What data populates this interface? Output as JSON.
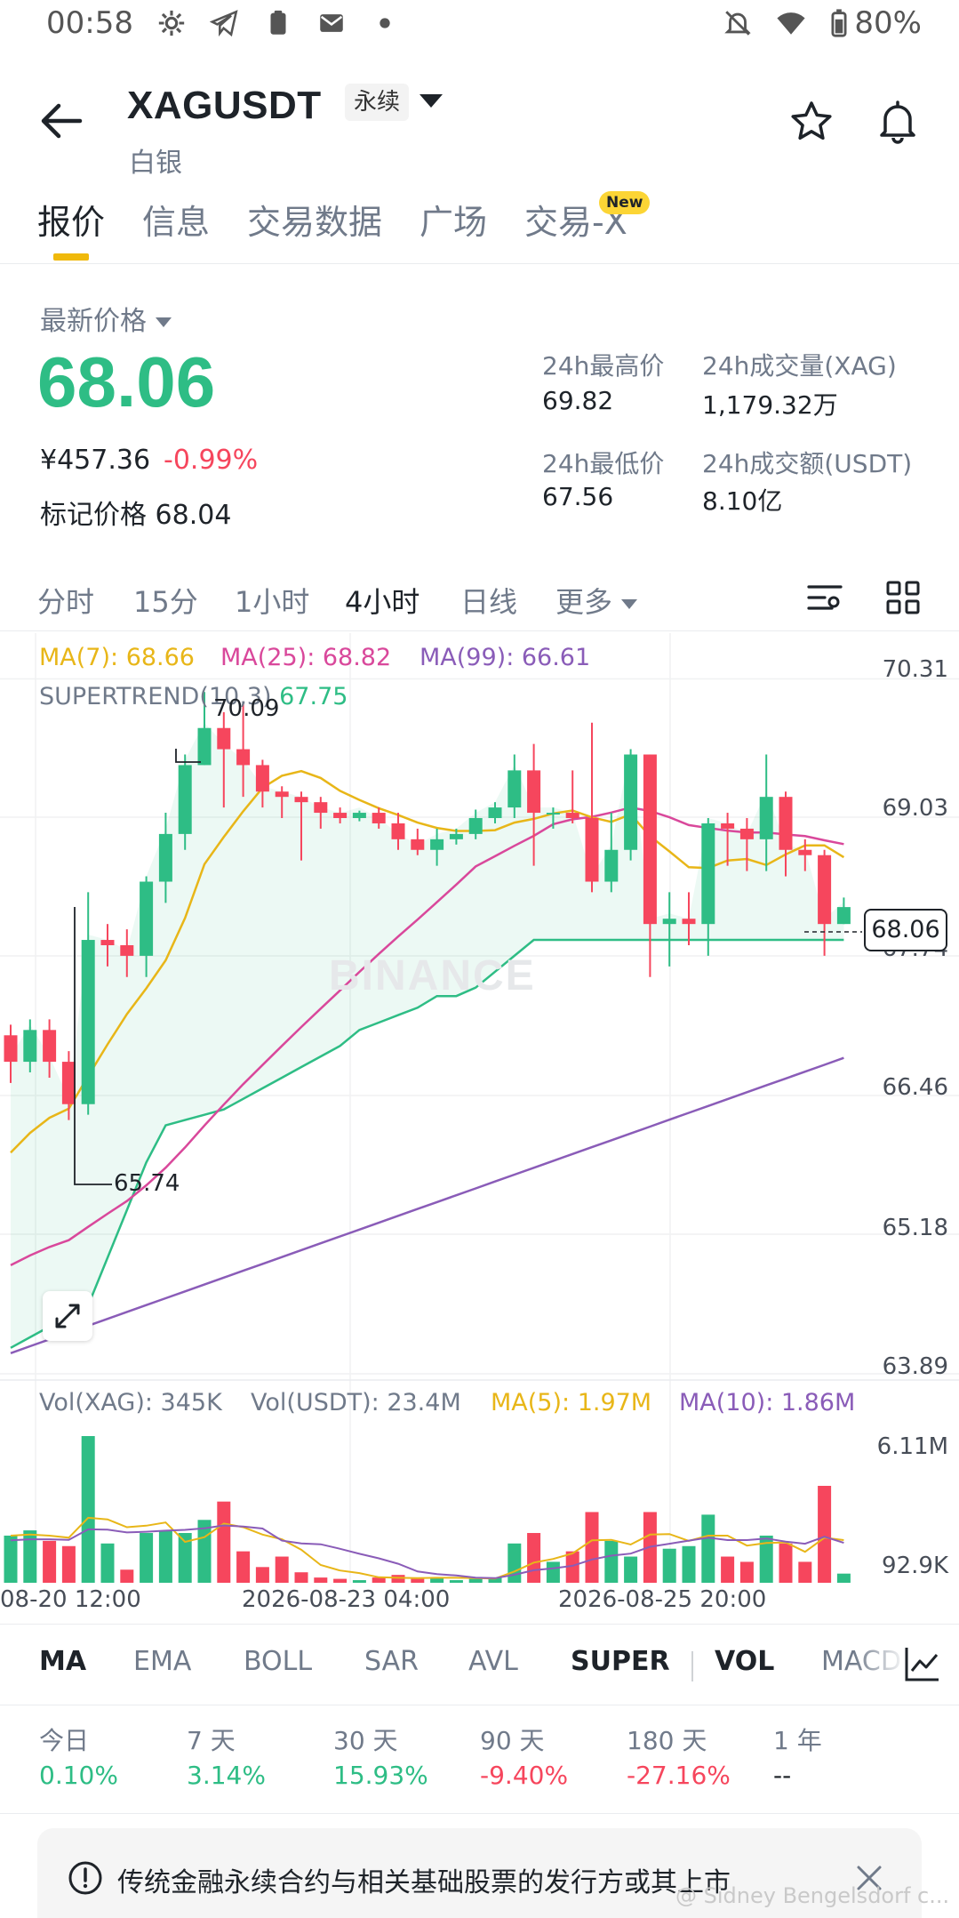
{
  "status_bar": {
    "time": "00:58",
    "battery": "80%"
  },
  "header": {
    "symbol": "XAGUSDT",
    "contract_type": "永续",
    "name": "白银"
  },
  "tabs": [
    {
      "label": "报价"
    },
    {
      "label": "信息"
    },
    {
      "label": "交易数据"
    },
    {
      "label": "广场"
    },
    {
      "label": "交易-X"
    }
  ],
  "new_badge": "New",
  "price": {
    "latest_label": "最新价格",
    "last": "68.06",
    "cny": "¥457.36",
    "change": "-0.99%",
    "mark_label": "标记价格",
    "mark": "68.04",
    "high_label": "24h最高价",
    "high": "69.82",
    "low_label": "24h最低价",
    "low": "67.56",
    "vol_label": "24h成交量(XAG)",
    "vol": "1,179.32万",
    "turnover_label": "24h成交额(USDT)",
    "turnover": "8.10亿"
  },
  "timeframes": [
    {
      "label": "分时"
    },
    {
      "label": "15分"
    },
    {
      "label": "1小时"
    },
    {
      "label": "4小时"
    },
    {
      "label": "日线"
    },
    {
      "label": "更多"
    }
  ],
  "legend": {
    "ma7": "MA(7): 68.66",
    "ma25": "MA(25): 68.82",
    "ma99": "MA(99): 66.61",
    "supertrend": "SUPERTREND(10,3)",
    "supertrend_val": "67.75",
    "vol_xag": "Vol(XAG): 345K",
    "vol_usdt": "Vol(USDT): 23.4M",
    "vol_ma5": "MA(5): 1.97M",
    "vol_ma10": "MA(10): 1.86M"
  },
  "watermark": "BINANCE",
  "current_price_tag": "68.06",
  "annotations": {
    "high": "70.09",
    "low": "65.74"
  },
  "colors": {
    "up": "#2ebd85",
    "down": "#f6465d",
    "ma7": "#e8b618",
    "ma25": "#d9489b",
    "ma99": "#8a5cb8",
    "supertrend": "#2ebd85",
    "accent": "#f0b90b"
  },
  "chart_data": {
    "type": "candlestick",
    "y_axis_labels": [
      "70.31",
      "69.03",
      "67.74",
      "66.46",
      "65.18",
      "63.89"
    ],
    "ylim": [
      63.89,
      70.31
    ],
    "vol_axis_labels": [
      "6.11M",
      "92.9K"
    ],
    "vol_ylim": [
      0,
      6.11
    ],
    "x_labels": [
      "08-20 12:00",
      "2026-08-23 04:00",
      "2026-08-25 20:00"
    ],
    "candles": [
      [
        66.85,
        66.6,
        66.95,
        66.4
      ],
      [
        66.6,
        66.9,
        67.0,
        66.5
      ],
      [
        66.9,
        66.6,
        67.0,
        66.45
      ],
      [
        66.6,
        66.2,
        66.7,
        66.05
      ],
      [
        66.2,
        67.75,
        68.2,
        66.1
      ],
      [
        67.75,
        67.7,
        67.9,
        67.5
      ],
      [
        67.7,
        67.6,
        67.85,
        67.4
      ],
      [
        67.6,
        68.3,
        68.35,
        67.4
      ],
      [
        68.3,
        68.75,
        68.95,
        68.1
      ],
      [
        68.75,
        69.4,
        69.5,
        68.6
      ],
      [
        69.4,
        69.75,
        70.09,
        69.4
      ],
      [
        69.75,
        69.55,
        69.9,
        69.0
      ],
      [
        69.55,
        69.4,
        70.0,
        69.1
      ],
      [
        69.4,
        69.15,
        69.45,
        69.0
      ],
      [
        69.15,
        69.1,
        69.2,
        68.9
      ],
      [
        69.1,
        69.05,
        69.15,
        68.5
      ],
      [
        69.05,
        68.95,
        69.1,
        68.8
      ],
      [
        68.95,
        68.9,
        69.0,
        68.85
      ],
      [
        68.9,
        68.95,
        68.97,
        68.87
      ],
      [
        68.95,
        68.85,
        69.0,
        68.8
      ],
      [
        68.85,
        68.7,
        68.95,
        68.6
      ],
      [
        68.7,
        68.6,
        68.8,
        68.55
      ],
      [
        68.6,
        68.7,
        68.8,
        68.45
      ],
      [
        68.7,
        68.75,
        68.8,
        68.65
      ],
      [
        68.75,
        68.9,
        68.98,
        68.7
      ],
      [
        68.9,
        69.0,
        69.05,
        68.85
      ],
      [
        69.0,
        69.35,
        69.5,
        68.9
      ],
      [
        69.35,
        68.95,
        69.6,
        68.45
      ],
      [
        68.95,
        68.95,
        69.0,
        68.8
      ],
      [
        68.95,
        68.9,
        69.35,
        68.85
      ],
      [
        68.9,
        68.3,
        69.8,
        68.2
      ],
      [
        68.3,
        68.6,
        68.95,
        68.2
      ],
      [
        68.6,
        69.5,
        69.55,
        68.5
      ],
      [
        69.5,
        67.9,
        69.5,
        67.4
      ],
      [
        67.9,
        67.95,
        68.2,
        67.5
      ],
      [
        67.95,
        67.9,
        68.2,
        67.7
      ],
      [
        67.9,
        68.85,
        68.9,
        67.6
      ],
      [
        68.85,
        68.8,
        68.95,
        68.45
      ],
      [
        68.8,
        68.7,
        68.9,
        68.4
      ],
      [
        68.7,
        69.1,
        69.5,
        68.4
      ],
      [
        69.1,
        68.6,
        69.15,
        68.35
      ],
      [
        68.6,
        68.55,
        68.7,
        68.4
      ],
      [
        68.55,
        67.9,
        68.6,
        67.6
      ],
      [
        67.9,
        68.06,
        68.15,
        67.9
      ]
    ],
    "volumes": [
      1.8,
      2.0,
      1.6,
      1.4,
      5.6,
      1.5,
      0.5,
      1.9,
      2.0,
      1.9,
      2.4,
      3.1,
      1.2,
      0.6,
      1.0,
      0.4,
      0.2,
      0.15,
      0.1,
      0.2,
      0.3,
      0.15,
      0.2,
      0.1,
      0.15,
      0.2,
      1.5,
      1.9,
      0.8,
      1.2,
      2.7,
      1.6,
      1.0,
      2.7,
      1.3,
      1.4,
      2.6,
      1.0,
      0.8,
      1.8,
      1.5,
      0.8,
      3.7,
      0.35
    ],
    "volume_up": [
      true,
      true,
      false,
      false,
      true,
      true,
      false,
      true,
      true,
      true,
      true,
      false,
      false,
      false,
      false,
      false,
      false,
      false,
      true,
      false,
      false,
      false,
      true,
      true,
      true,
      true,
      true,
      false,
      true,
      false,
      false,
      true,
      true,
      false,
      true,
      true,
      true,
      false,
      false,
      true,
      false,
      false,
      false,
      true
    ]
  },
  "indicator_tabs": [
    {
      "label": "MA"
    },
    {
      "label": "EMA"
    },
    {
      "label": "BOLL"
    },
    {
      "label": "SAR"
    },
    {
      "label": "AVL"
    },
    {
      "label": "SUPER"
    },
    {
      "label": "VOL"
    },
    {
      "label": "MACD"
    }
  ],
  "performance": [
    {
      "label": "今日",
      "value": "0.10%",
      "dir": "up"
    },
    {
      "label": "7 天",
      "value": "3.14%",
      "dir": "up"
    },
    {
      "label": "30 天",
      "value": "15.93%",
      "dir": "up"
    },
    {
      "label": "90 天",
      "value": "-9.40%",
      "dir": "down"
    },
    {
      "label": "180 天",
      "value": "-27.16%",
      "dir": "down"
    },
    {
      "label": "1 年",
      "value": "--",
      "dir": "none"
    }
  ],
  "notice": {
    "text": "传统金融永续合约与相关基础股票的发行方或其上市"
  },
  "corner_watermark": "@ Sidney Bengelsdorf c..."
}
